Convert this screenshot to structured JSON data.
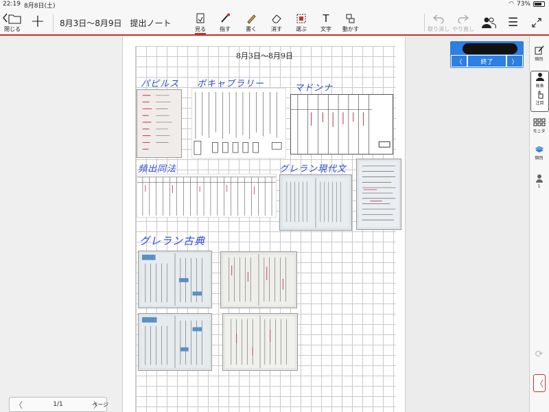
{
  "status": {
    "time": "22:19",
    "date": "8月8日(土)",
    "battery": "73%"
  },
  "toolbar": {
    "close_label": "閉じる",
    "title": "8月3日〜8月9日　提出ノート",
    "tools": [
      {
        "id": "view",
        "label": "見る",
        "icon": "eye-doc-icon",
        "active": true
      },
      {
        "id": "point",
        "label": "指す",
        "icon": "pointer-pen-icon"
      },
      {
        "id": "write",
        "label": "書く",
        "icon": "pencil-icon"
      },
      {
        "id": "erase",
        "label": "消す",
        "icon": "eraser-icon"
      },
      {
        "id": "select",
        "label": "選ぶ",
        "icon": "select-icon"
      },
      {
        "id": "text",
        "label": "文字",
        "icon": "text-icon"
      },
      {
        "id": "move",
        "label": "動かす",
        "icon": "move-icon"
      }
    ],
    "undo_label": "取り消し",
    "redo_label": "やり直し"
  },
  "note": {
    "heading": "8月3日〜8月9日",
    "labels": {
      "papyrus": "パピルス",
      "vocabulary": "ボキャブラリー",
      "madonna": "マドンナ",
      "frequent": "頻出同法",
      "green_modern": "グレラン現代文",
      "green_classic": "グレラン古典"
    }
  },
  "pager": {
    "current": "1/1",
    "page_label": "ページ"
  },
  "presenter": {
    "end_label": "終了"
  },
  "sidebar": {
    "items": [
      {
        "label": "個別",
        "icon": "edit-note-icon"
      },
      {
        "label": "発表",
        "icon": "present-user-icon"
      },
      {
        "label": "注目",
        "icon": "hand-attention-icon"
      },
      {
        "label": "モニタ",
        "icon": "monitor-grid-icon"
      },
      {
        "label": "個別",
        "icon": "layers-icon"
      },
      {
        "label": "1",
        "icon": "person-icon"
      }
    ]
  },
  "colors": {
    "accent": "#c8302b",
    "handwriting": "#2b4bd8",
    "present_blue": "#2d7fe0"
  }
}
